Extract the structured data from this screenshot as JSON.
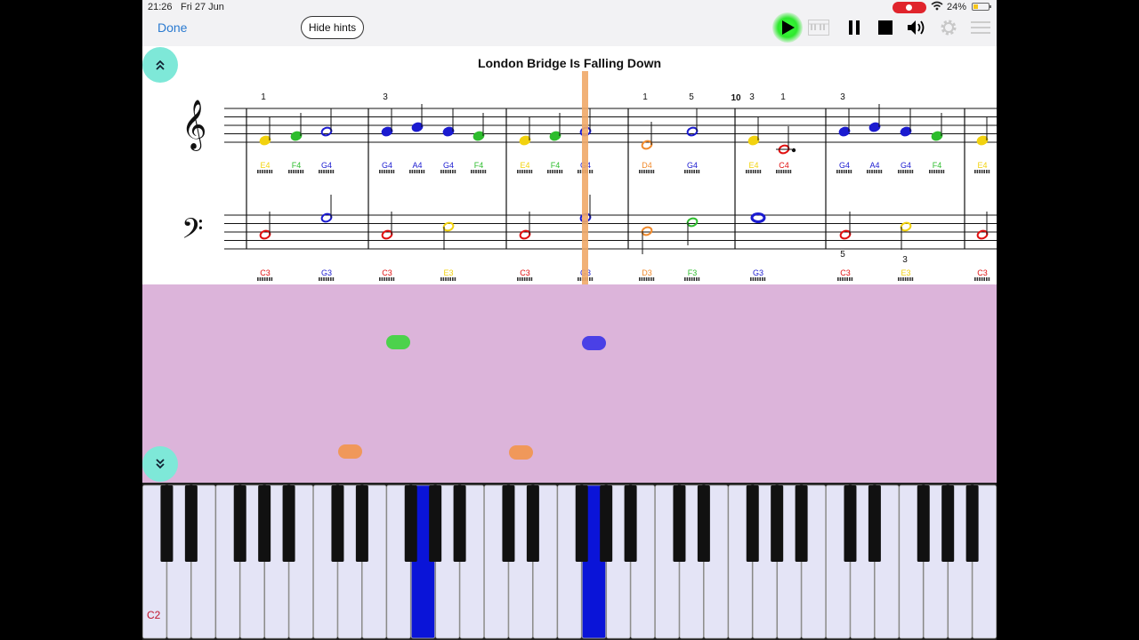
{
  "status_bar": {
    "time": "21:26",
    "date": "Fri 27 Jun",
    "battery": "24%",
    "battery_fraction": 0.24
  },
  "toolbar": {
    "done_label": "Done",
    "hints_label": "Hide hints",
    "icons": [
      "play-icon",
      "piano-icon",
      "pause-icon",
      "stop-icon",
      "speaker-icon",
      "gear-icon",
      "menu-icon"
    ],
    "play_color": "#2ee82e"
  },
  "score": {
    "title": "London Bridge Is Falling Down",
    "measure_number": "10",
    "fingerings_treble": [
      "1",
      "3",
      "1",
      "5",
      "3",
      "1",
      "3"
    ],
    "fingerings_bass": [
      "5",
      "3"
    ],
    "treble_notes": [
      {
        "name": "E4",
        "color": "#f2d20f"
      },
      {
        "name": "F4",
        "color": "#2ebd2e"
      },
      {
        "name": "G4",
        "color": "#1b1bd0"
      },
      {
        "name": "G4",
        "color": "#1b1bd0"
      },
      {
        "name": "A4",
        "color": "#1b1bd0"
      },
      {
        "name": "G4",
        "color": "#1b1bd0"
      },
      {
        "name": "F4",
        "color": "#2ebd2e"
      },
      {
        "name": "E4",
        "color": "#f2d20f"
      },
      {
        "name": "F4",
        "color": "#2ebd2e"
      },
      {
        "name": "G4",
        "color": "#1b1bd0"
      },
      {
        "name": "D4",
        "color": "#f08a2c"
      },
      {
        "name": "G4",
        "color": "#1b1bd0"
      },
      {
        "name": "E4",
        "color": "#f2d20f"
      },
      {
        "name": "C4",
        "color": "#e01010"
      },
      {
        "name": "G4",
        "color": "#1b1bd0"
      },
      {
        "name": "A4",
        "color": "#1b1bd0"
      },
      {
        "name": "G4",
        "color": "#1b1bd0"
      },
      {
        "name": "F4",
        "color": "#2ebd2e"
      },
      {
        "name": "E4",
        "color": "#f2d20f"
      }
    ],
    "bass_notes": [
      {
        "name": "C3",
        "color": "#e01010"
      },
      {
        "name": "G3",
        "color": "#1b1bd0"
      },
      {
        "name": "C3",
        "color": "#e01010"
      },
      {
        "name": "E3",
        "color": "#f2d20f"
      },
      {
        "name": "C3",
        "color": "#e01010"
      },
      {
        "name": "G3",
        "color": "#1b1bd0"
      },
      {
        "name": "D3",
        "color": "#f08a2c"
      },
      {
        "name": "F3",
        "color": "#2ebd2e"
      },
      {
        "name": "G3",
        "color": "#1b1bd0"
      },
      {
        "name": "C3",
        "color": "#e01010"
      },
      {
        "name": "E3",
        "color": "#f2d20f"
      },
      {
        "name": "C3",
        "color": "#e01010"
      }
    ],
    "playhead_color": "#f0a868"
  },
  "falling_notes": [
    {
      "color": "#4cd24c"
    },
    {
      "color": "#4a40e6"
    },
    {
      "color": "#f0985a"
    },
    {
      "color": "#f0985a"
    }
  ],
  "keyboard": {
    "lowest_key_label": "C2",
    "pressed_color": "#0a14d8"
  },
  "colors": {
    "lane_bg": "#dcb4da",
    "round_button": "#7ee8d8",
    "done_link": "#2a7ad0"
  }
}
